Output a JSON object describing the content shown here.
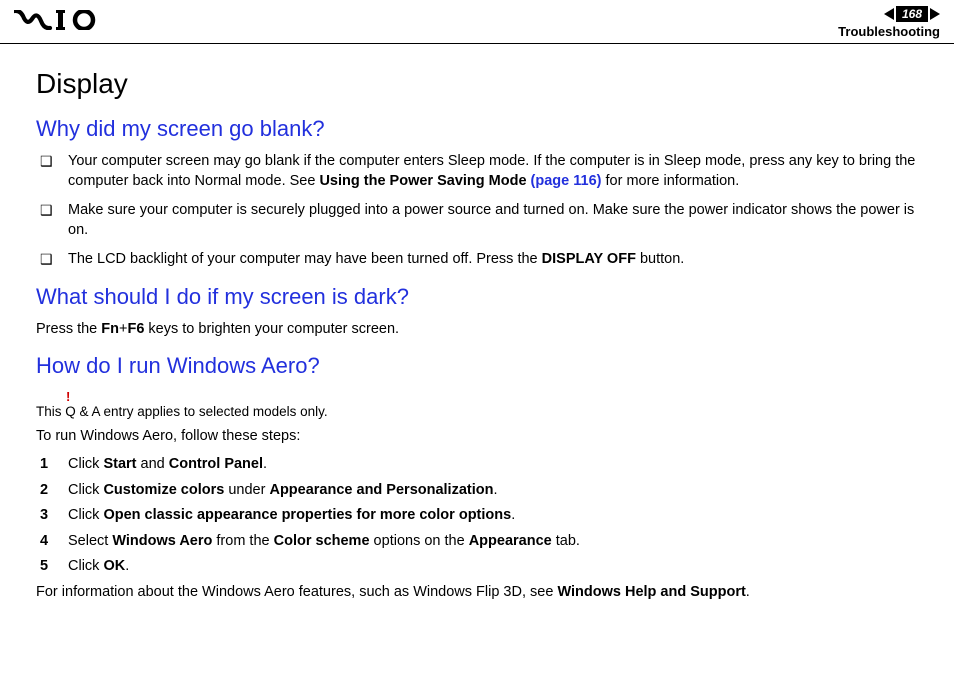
{
  "header": {
    "page_number": "168",
    "section": "Troubleshooting"
  },
  "title": "Display",
  "q1": {
    "heading": "Why did my screen go blank?",
    "items": [
      {
        "pre": "Your computer screen may go blank if the computer enters Sleep mode. If the computer is in Sleep mode, press any key to bring the computer back into Normal mode. See ",
        "b1": "Using the Power Saving Mode ",
        "link": "(page 116)",
        "post": " for more information."
      },
      {
        "text": "Make sure your computer is securely plugged into a power source and turned on. Make sure the power indicator shows the power is on."
      },
      {
        "pre2": "The LCD backlight of your computer may have been turned off. Press the ",
        "b2": "DISPLAY OFF",
        "post2": " button."
      }
    ]
  },
  "q2": {
    "heading": "What should I do if my screen is dark?",
    "para_pre": "Press the ",
    "b1": "Fn",
    "plus": "+",
    "b2": "F6",
    "para_post": " keys to brighten your computer screen."
  },
  "q3": {
    "heading": "How do I run Windows Aero?",
    "bang": "!",
    "note": "This Q & A entry applies to selected models only.",
    "intro": "To run Windows Aero, follow these steps:",
    "steps": [
      {
        "t0": "Click ",
        "b0": "Start",
        "t1": " and ",
        "b1": "Control Panel",
        "t2": "."
      },
      {
        "t0": "Click ",
        "b0": "Customize colors",
        "t1": " under ",
        "b1": "Appearance and Personalization",
        "t2": "."
      },
      {
        "t0": "Click ",
        "b0": "Open classic appearance properties for more color options",
        "t1": ".",
        "b1": "",
        "t2": ""
      },
      {
        "t0": "Select ",
        "b0": "Windows Aero",
        "t1": " from the ",
        "b1": "Color scheme",
        "t2": " options on the ",
        "b2": "Appearance",
        "t3": " tab."
      },
      {
        "t0": "Click ",
        "b0": "OK",
        "t1": ".",
        "b1": "",
        "t2": ""
      }
    ],
    "outro_pre": "For information about the Windows Aero features, such as Windows Flip 3D, see ",
    "outro_b": "Windows Help and Support",
    "outro_post": "."
  }
}
